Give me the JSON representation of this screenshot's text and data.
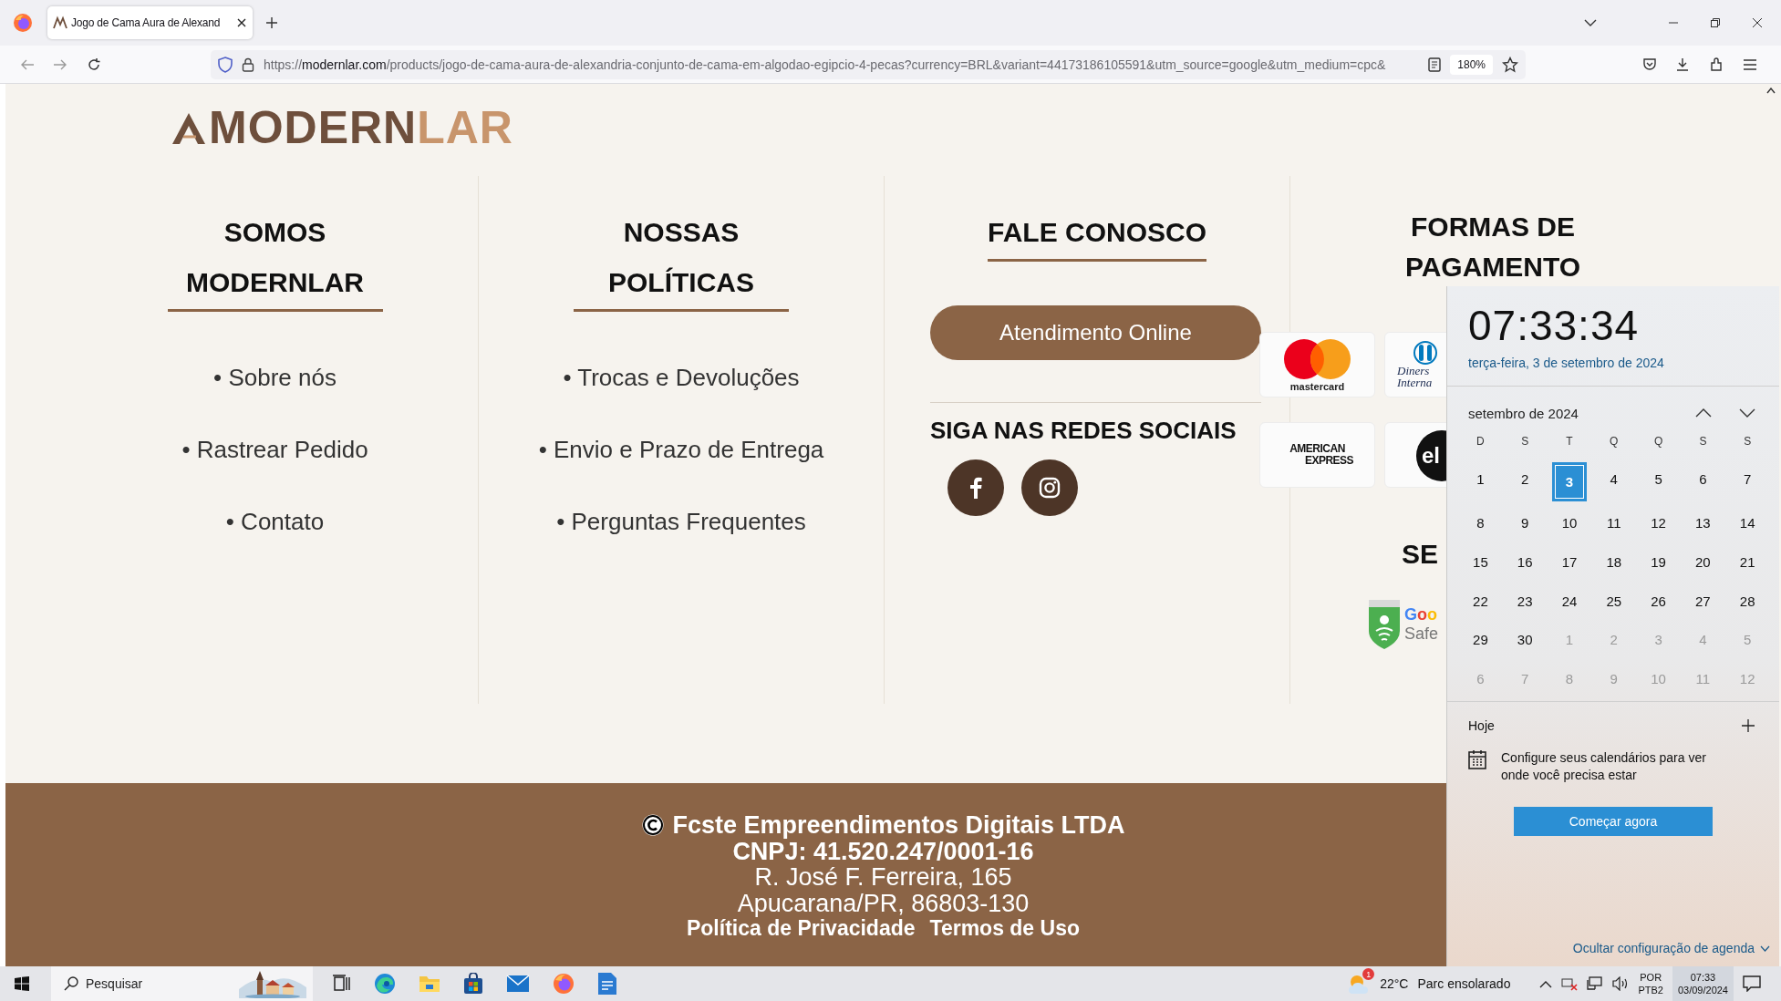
{
  "browser": {
    "tab_title": "Jogo de Cama Aura de Alexand",
    "url": "https://**modernlar.com**/products/jogo-de-cama-aura-de-alexandria-conjunto-de-cama-em-algodao-egipcio-4-pecas?currency=BRL&variant=44173186105591&utm_source=google&utm_medium=cpc&",
    "zoom": "180%"
  },
  "page": {
    "logo": "MODERN**LAR**",
    "columns": [
      {
        "kind": "links",
        "heading": [
          "SOMOS",
          "MODERNLAR"
        ],
        "links": [
          "• Sobre nós",
          "• Rastrear Pedido",
          "• Contato"
        ]
      },
      {
        "kind": "links",
        "heading": [
          "NOSSAS",
          "POLÍTICAS"
        ],
        "links": [
          "• Trocas e Devoluções",
          "• Envio e Prazo de Entrega",
          "• Perguntas Frequentes"
        ]
      },
      {
        "kind": "contact",
        "heading": [
          "FALE CONOSCO"
        ],
        "button": "Atendimento Online",
        "social_title": "SIGA NAS REDES SOCIAIS"
      },
      {
        "kind": "payment",
        "heading": [
          "FORMAS DE",
          "PAGAMENTO"
        ],
        "cards": [
          {
            "kind": "mastercard",
            "lines": [
              "mastercard"
            ]
          },
          {
            "kind": "diners",
            "lines": [
              "Diners",
              "Interna"
            ]
          },
          {
            "kind": "amex",
            "lines": [
              "AMERICAN",
              "EXPRESS"
            ]
          },
          {
            "kind": "elo",
            "lines": [
              "el"
            ]
          }
        ],
        "security_heading": "SE",
        "badge_lines": [
          "Goo",
          "Safe"
        ]
      }
    ],
    "footer": {
      "company": "Fcste Empreendimentos Digitais LTDA",
      "cnpj": "CNPJ: 41.520.247/0001-16",
      "address_lines": [
        "R. José F. Ferreira, 165",
        "Apucarana/PR, 86803-130"
      ],
      "links": [
        "Política de Privacidade",
        "Termos de Uso"
      ]
    }
  },
  "calendar_flyout": {
    "time": "07:33:34",
    "date": "terça-feira, 3 de setembro de 2024",
    "month": "setembro de 2024",
    "weekdays": [
      "D",
      "S",
      "T",
      "Q",
      "Q",
      "S",
      "S"
    ],
    "days": [
      {
        "label": "1",
        "selected": false,
        "outside": false
      },
      {
        "label": "2",
        "selected": false,
        "outside": false
      },
      {
        "label": "3",
        "selected": true,
        "outside": false
      },
      {
        "label": "4",
        "selected": false,
        "outside": false
      },
      {
        "label": "5",
        "selected": false,
        "outside": false
      },
      {
        "label": "6",
        "selected": false,
        "outside": false
      },
      {
        "label": "7",
        "selected": false,
        "outside": false
      },
      {
        "label": "8",
        "selected": false,
        "outside": false
      },
      {
        "label": "9",
        "selected": false,
        "outside": false
      },
      {
        "label": "10",
        "selected": false,
        "outside": false
      },
      {
        "label": "11",
        "selected": false,
        "outside": false
      },
      {
        "label": "12",
        "selected": false,
        "outside": false
      },
      {
        "label": "13",
        "selected": false,
        "outside": false
      },
      {
        "label": "14",
        "selected": false,
        "outside": false
      },
      {
        "label": "15",
        "selected": false,
        "outside": false
      },
      {
        "label": "16",
        "selected": false,
        "outside": false
      },
      {
        "label": "17",
        "selected": false,
        "outside": false
      },
      {
        "label": "18",
        "selected": false,
        "outside": false
      },
      {
        "label": "19",
        "selected": false,
        "outside": false
      },
      {
        "label": "20",
        "selected": false,
        "outside": false
      },
      {
        "label": "21",
        "selected": false,
        "outside": false
      },
      {
        "label": "22",
        "selected": false,
        "outside": false
      },
      {
        "label": "23",
        "selected": false,
        "outside": false
      },
      {
        "label": "24",
        "selected": false,
        "outside": false
      },
      {
        "label": "25",
        "selected": false,
        "outside": false
      },
      {
        "label": "26",
        "selected": false,
        "outside": false
      },
      {
        "label": "27",
        "selected": false,
        "outside": false
      },
      {
        "label": "28",
        "selected": false,
        "outside": false
      },
      {
        "label": "29",
        "selected": false,
        "outside": false
      },
      {
        "label": "30",
        "selected": false,
        "outside": false
      },
      {
        "label": "1",
        "selected": false,
        "outside": true
      },
      {
        "label": "2",
        "selected": false,
        "outside": true
      },
      {
        "label": "3",
        "selected": false,
        "outside": true
      },
      {
        "label": "4",
        "selected": false,
        "outside": true
      },
      {
        "label": "5",
        "selected": false,
        "outside": true
      },
      {
        "label": "6",
        "selected": false,
        "outside": true
      },
      {
        "label": "7",
        "selected": false,
        "outside": true
      },
      {
        "label": "8",
        "selected": false,
        "outside": true
      },
      {
        "label": "9",
        "selected": false,
        "outside": true
      },
      {
        "label": "10",
        "selected": false,
        "outside": true
      },
      {
        "label": "11",
        "selected": false,
        "outside": true
      },
      {
        "label": "12",
        "selected": false,
        "outside": true
      }
    ],
    "today_label": "Hoje",
    "prompt": "Configure seus calendários para ver onde você precisa estar",
    "start_button": "Começar agora",
    "hide_link": "Ocultar configuração de agenda"
  },
  "taskbar": {
    "search": {
      "placeholder": "Pesquisar"
    },
    "weather_badge": "1",
    "temperature": "22°C",
    "weather": "Parc ensolarado",
    "language": [
      "POR",
      "PTB2"
    ],
    "time": "07:33",
    "date": "03/09/2024"
  }
}
